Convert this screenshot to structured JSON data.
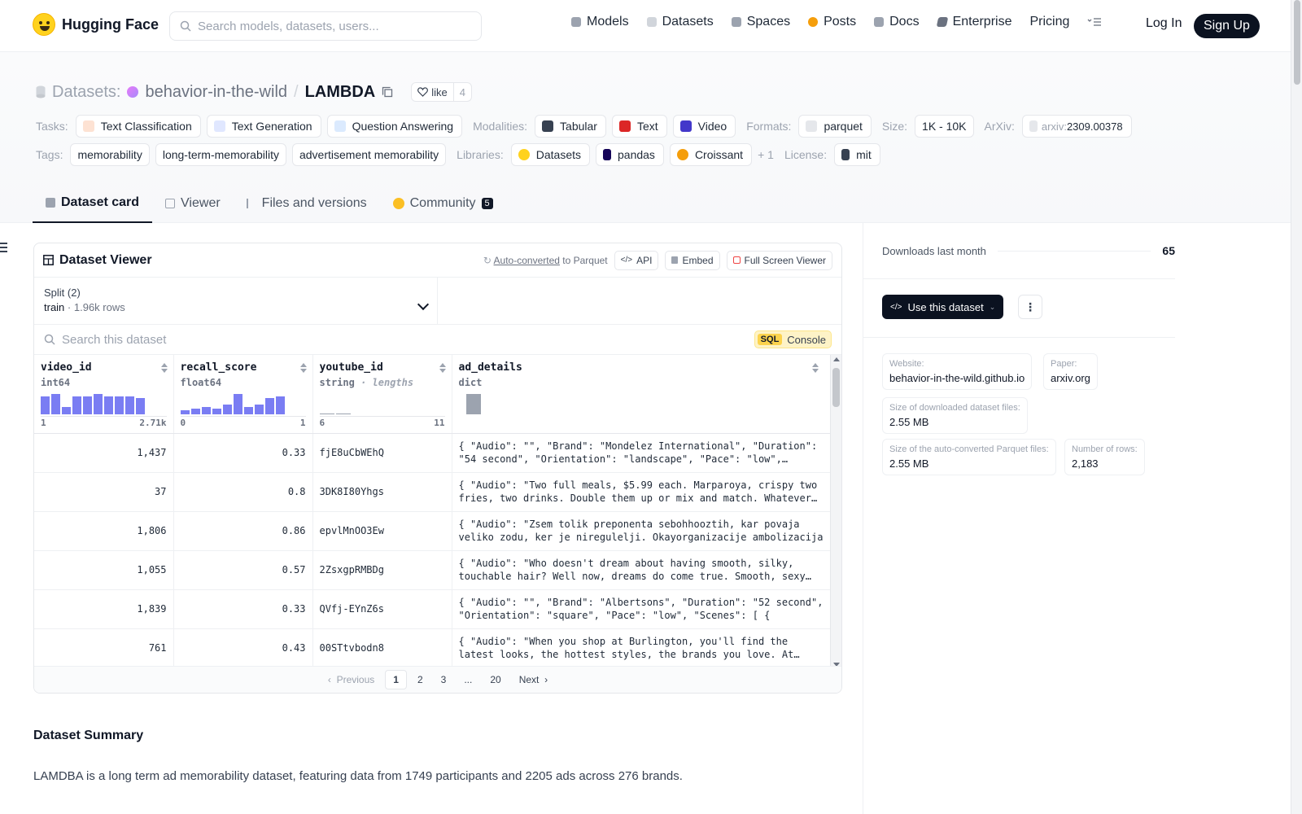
{
  "brand": {
    "name": "Hugging Face"
  },
  "search": {
    "placeholder": "Search models, datasets, users..."
  },
  "nav": {
    "items": [
      {
        "label": "Models",
        "color": "#9ca3af"
      },
      {
        "label": "Datasets",
        "color": "#d1d5db"
      },
      {
        "label": "Spaces",
        "color": "#9ca3af"
      },
      {
        "label": "Posts",
        "color": "#f59e0b"
      },
      {
        "label": "Docs",
        "color": "#9ca3af"
      },
      {
        "label": "Enterprise",
        "color": "#6b7280"
      },
      {
        "label": "Pricing",
        "color": ""
      }
    ],
    "login": "Log In",
    "signup": "Sign Up"
  },
  "repo": {
    "type_label": "Datasets:",
    "owner": "behavior-in-the-wild",
    "separator": "/",
    "name": "LAMBDA",
    "like_label": "like",
    "like_count": "4"
  },
  "tags": {
    "tasks_label": "Tasks:",
    "tasks": [
      "Text Classification",
      "Text Generation",
      "Question Answering"
    ],
    "modalities_label": "Modalities:",
    "modalities": [
      "Tabular",
      "Text",
      "Video"
    ],
    "formats_label": "Formats:",
    "formats": [
      "parquet"
    ],
    "size_label": "Size:",
    "size": "1K - 10K",
    "arxiv_label": "ArXiv:",
    "arxiv_prefix": "arxiv:",
    "arxiv_id": "2309.00378",
    "tags_label": "Tags:",
    "tags": [
      "memorability",
      "long-term-memorability",
      "advertisement memorability"
    ],
    "libraries_label": "Libraries:",
    "libraries": [
      "Datasets",
      "pandas",
      "Croissant"
    ],
    "libraries_more": "+ 1",
    "license_label": "License:",
    "license": "mit"
  },
  "tabs": [
    {
      "label": "Dataset card",
      "active": true
    },
    {
      "label": "Viewer"
    },
    {
      "label": "Files and versions"
    },
    {
      "label": "Community",
      "badge": "5"
    }
  ],
  "viewer": {
    "title": "Dataset Viewer",
    "converted_link": "Auto-converted",
    "converted_suffix": " to Parquet",
    "api_label": "API",
    "embed_label": "Embed",
    "fullscreen_label": "Full Screen Viewer",
    "split_label": "Split (2)",
    "split_value": "train",
    "split_rows": "1.96k rows",
    "search_placeholder": "Search this dataset",
    "sql_tag": "SQL",
    "sql_label": "Console",
    "columns": [
      {
        "name": "video_id",
        "type": "int64",
        "hist": [
          0.85,
          0.95,
          0.35,
          0.85,
          0.85,
          0.95,
          0.85,
          0.85,
          0.85,
          0.75
        ],
        "min": "1",
        "max": "2.71k"
      },
      {
        "name": "recall_score",
        "type": "float64",
        "hist": [
          0.2,
          0.25,
          0.35,
          0.25,
          0.45,
          0.95,
          0.35,
          0.45,
          0.75,
          0.85
        ],
        "min": "0",
        "max": "1"
      },
      {
        "name": "youtube_id",
        "type": "string",
        "type_extra": " · lengths",
        "hist": [
          0.05,
          0.05,
          0.0,
          0.0,
          0.0,
          0.0,
          0.0,
          0.0,
          0.0,
          0.95
        ],
        "min": "6",
        "max": "11"
      },
      {
        "name": "ad_details",
        "type": "dict"
      }
    ],
    "rows": [
      {
        "video_id": "1,437",
        "recall_score": "0.33",
        "youtube_id": "fjE8uCbWEhQ",
        "ad_details": "{ \"Audio\": \"\", \"Brand\": \"Mondelez International\", \"Duration\": \"54 second\", \"Orientation\": \"landscape\", \"Pace\": \"low\", \"Scenes\": [ {"
      },
      {
        "video_id": "37",
        "recall_score": "0.8",
        "youtube_id": "3DK8I80Yhgs",
        "ad_details": "{ \"Audio\": \"Two full meals, $5.99 each. Marparoya, crispy two fries, two drinks. Double them up or mix and match. Whatever you want."
      },
      {
        "video_id": "1,806",
        "recall_score": "0.86",
        "youtube_id": "epvlMnOO3Ew",
        "ad_details": "{ \"Audio\": \"Zsem tolik preponenta sebohhooztih, kar povaja veliko zodu, ker je niregulelji. Okayorganizacije ambolizacija"
      },
      {
        "video_id": "1,055",
        "recall_score": "0.57",
        "youtube_id": "2ZsxgpRMBDg",
        "ad_details": "{ \"Audio\": \"Who doesn't dream about having smooth, silky, touchable hair? Well now, dreams do come true. Smooth, sexy hair"
      },
      {
        "video_id": "1,839",
        "recall_score": "0.33",
        "youtube_id": "QVfj-EYnZ6s",
        "ad_details": "{ \"Audio\": \"\", \"Brand\": \"Albertsons\", \"Duration\": \"52 second\", \"Orientation\": \"square\", \"Pace\": \"low\", \"Scenes\": [ {"
      },
      {
        "video_id": "761",
        "recall_score": "0.43",
        "youtube_id": "00STtvbodn8",
        "ad_details": "{ \"Audio\": \"When you shop at Burlington, you'll find the latest looks, the hottest styles, the brands you love. At Burlington"
      }
    ],
    "pager": {
      "prev": "Previous",
      "pages": [
        "1",
        "2",
        "3",
        "...",
        "20"
      ],
      "next": "Next"
    }
  },
  "summary": {
    "heading": "Dataset Summary",
    "text": "LAMDBA is a long term ad memorability dataset, featuring data from 1749 participants and 2205 ads across 276 brands."
  },
  "sidebar": {
    "downloads_label": "Downloads last month",
    "downloads_value": "65",
    "use_button": "Use this dataset",
    "website_label": "Website:",
    "website": "behavior-in-the-wild.github.io",
    "paper_label": "Paper:",
    "paper": "arxiv.org",
    "dl_size_label": "Size of downloaded dataset files:",
    "dl_size": "2.55 MB",
    "parquet_size_label": "Size of the auto-converted Parquet files:",
    "parquet_size": "2.55 MB",
    "rows_label": "Number of rows:",
    "rows": "2,183"
  }
}
